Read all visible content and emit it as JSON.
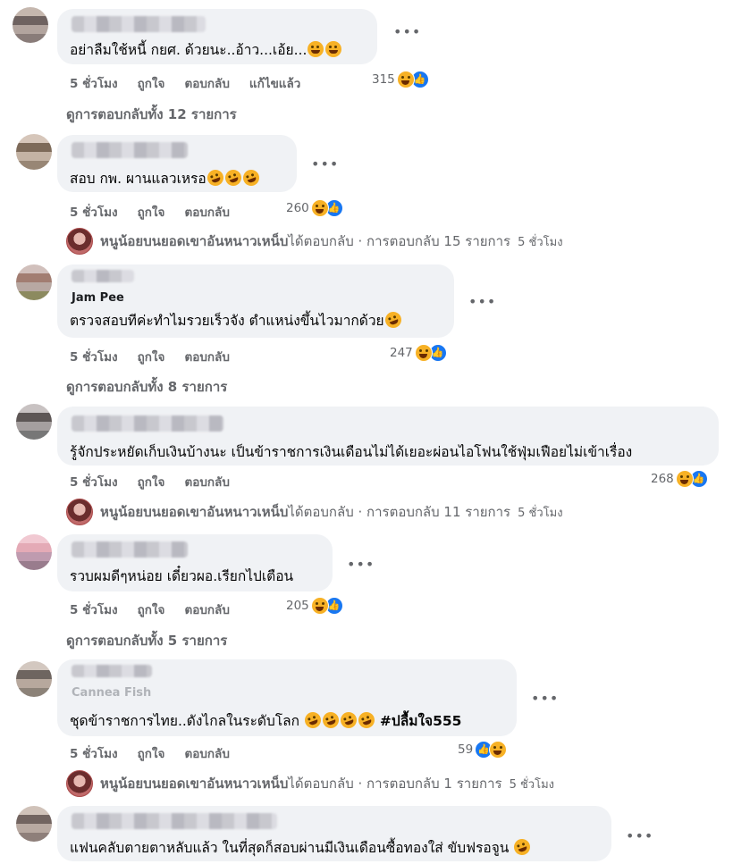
{
  "comments": [
    {
      "author": "",
      "text": "อย่าลืมใช้หนี้ กยศ. ด้วยนะ..อ้าว...เอ้ย...",
      "time": "5 ชั่วโมง",
      "like": "ถูกใจ",
      "reply": "ตอบกลับ",
      "edited": "แก้ไขแล้ว",
      "reactions": "315",
      "replies_link": "ดูการตอบกลับทั้ง 12 รายการ"
    },
    {
      "author": "",
      "text": "สอบ กพ. ผานแลวเหรอ",
      "time": "5 ชั่วโมง",
      "like": "ถูกใจ",
      "reply": "ตอบกลับ",
      "reactions": "260",
      "reply_summary": {
        "name": "หนูน้อยบนยอดเขาอันหนาวเหน็บ",
        "action": " ได้ตอบกลับ · การตอบกลับ 15 รายการ",
        "time": "5 ชั่วโมง"
      }
    },
    {
      "author": "Jam Pee",
      "text": "ตรวจสอบทีค่ะทำไมรวยเร็วจัง ตำแหน่งขึ้นไวมากด้วย",
      "time": "5 ชั่วโมง",
      "like": "ถูกใจ",
      "reply": "ตอบกลับ",
      "reactions": "247",
      "replies_link": "ดูการตอบกลับทั้ง 8 รายการ"
    },
    {
      "author": "",
      "text": "รู้จักประหยัดเก็บเงินบ้างนะ เป็นข้าราชการเงินเดือนไม่ได้เยอะผ่อนไอโฟนใช้ฟุ่มเฟือยไม่เข้าเรื่อง",
      "time": "5 ชั่วโมง",
      "like": "ถูกใจ",
      "reply": "ตอบกลับ",
      "reactions": "268",
      "reply_summary": {
        "name": "หนูน้อยบนยอดเขาอันหนาวเหน็บ",
        "action": " ได้ตอบกลับ · การตอบกลับ 11 รายการ",
        "time": "5 ชั่วโมง"
      }
    },
    {
      "author": "",
      "text": "รวบผมดีๆหน่อย เดี๋ยวผอ.เรียกไปเตือน",
      "time": "5 ชั่วโมง",
      "like": "ถูกใจ",
      "reply": "ตอบกลับ",
      "reactions": "205",
      "replies_link": "ดูการตอบกลับทั้ง 5 รายการ"
    },
    {
      "author": "Cannea Fish",
      "text": "ชุดข้าราชการไทย..ดังไกลในระดับโลก",
      "hashtag": "#ปลื้มใจ555",
      "time": "5 ชั่วโมง",
      "like": "ถูกใจ",
      "reply": "ตอบกลับ",
      "reactions": "59",
      "reply_summary": {
        "name": "หนูน้อยบนยอดเขาอันหนาวเหน็บ",
        "action": " ได้ตอบกลับ · การตอบกลับ 1 รายการ",
        "time": "5 ชั่วโมง"
      }
    },
    {
      "author": "",
      "text": "แฟนคลับตายตาหลับแล้ว ในที่สุดก็สอบผ่านมีเงินเดือนซื้อทองใส่ ขับฟรอจูน"
    }
  ],
  "more_icon": "more-dots-icon",
  "colors": {
    "bubble": "#f0f2f5",
    "meta": "#65676b",
    "text": "#050505",
    "like_blue": "#1877f2",
    "haha_yellow": "#f7b125"
  }
}
